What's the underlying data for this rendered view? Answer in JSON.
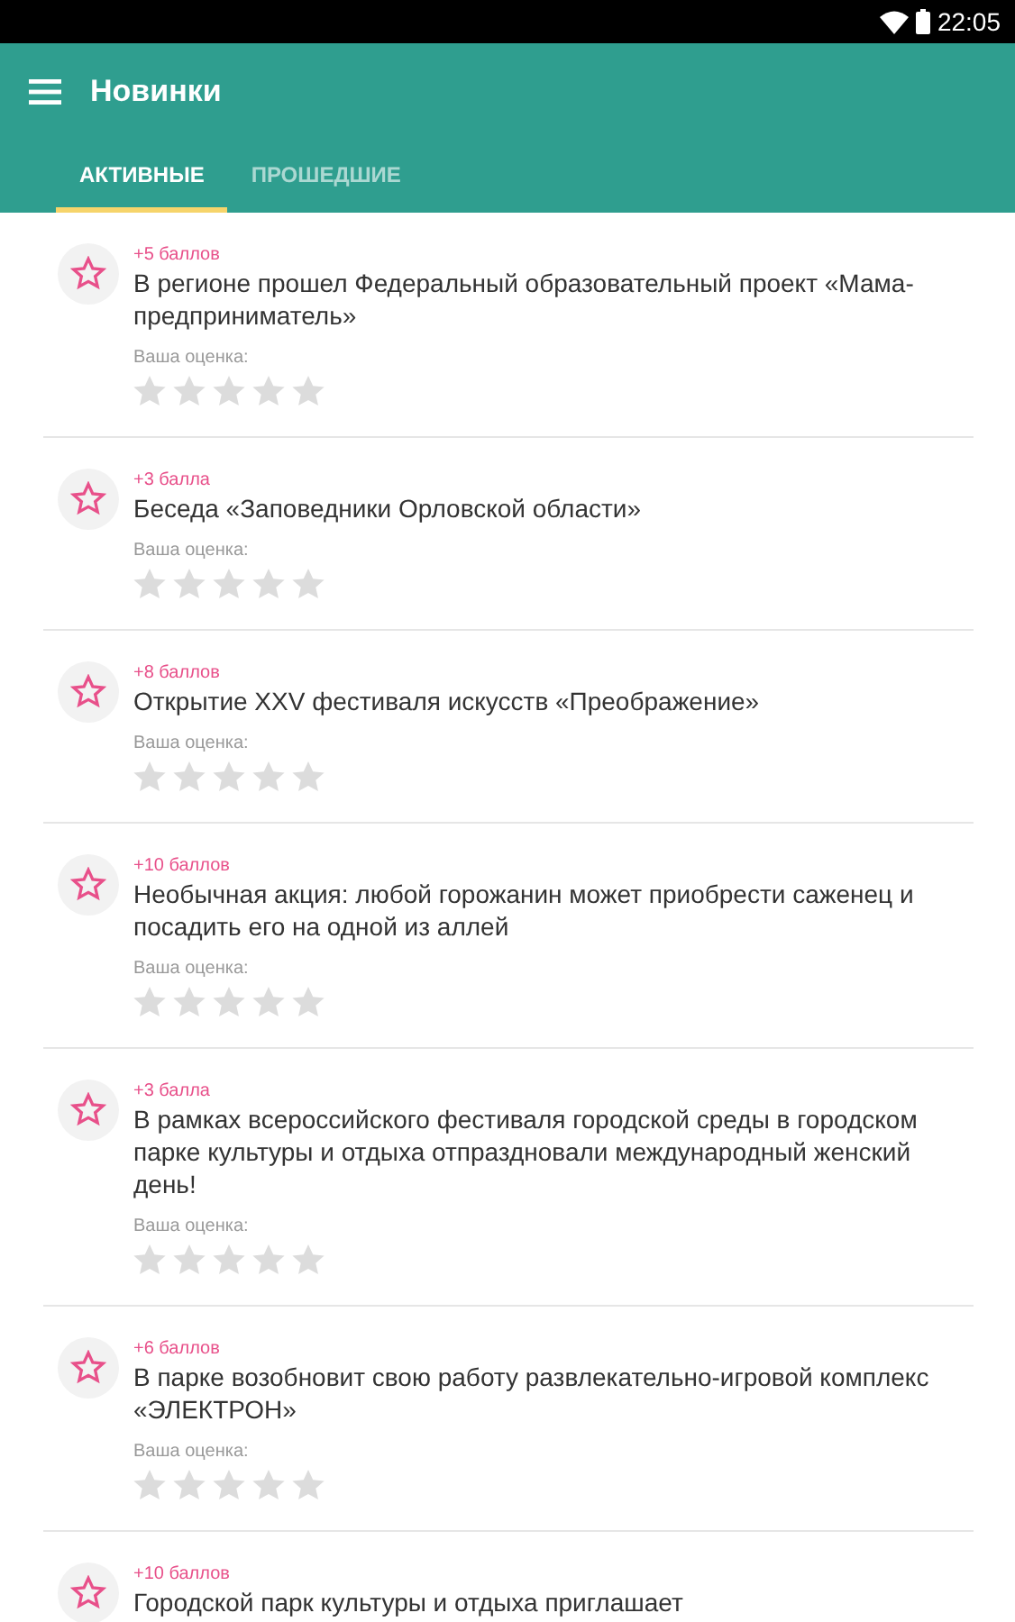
{
  "status_bar": {
    "time": "22:05"
  },
  "app_bar": {
    "title": "Новинки"
  },
  "tabs": [
    {
      "label": "АКТИВНЫЕ",
      "selected": true
    },
    {
      "label": "ПРОШЕДШИЕ",
      "selected": false
    }
  ],
  "items": [
    {
      "points": "+5 баллов",
      "title": "В регионе прошел Федеральный образовательный проект «Мама-предприниматель»",
      "rating_label": "Ваша оценка:",
      "stars": 0
    },
    {
      "points": "+3 балла",
      "title": "Беседа «Заповедники Орловской области»",
      "rating_label": "Ваша оценка:",
      "stars": 0
    },
    {
      "points": "+8 баллов",
      "title": "Открытие XXV фестиваля искусств «Преображение»",
      "rating_label": "Ваша оценка:",
      "stars": 0
    },
    {
      "points": "+10 баллов",
      "title": "Необычная акция: любой горожанин может приобрести саженец и посадить его на одной из аллей",
      "rating_label": "Ваша оценка:",
      "stars": 0
    },
    {
      "points": "+3 балла",
      "title": "В рамках всероссийского фестиваля городской среды в городском парке культуры и отдыха отпраздновали международный женский день!",
      "rating_label": "Ваша оценка:",
      "stars": 0
    },
    {
      "points": "+6 баллов",
      "title": "В парке возобновит свою работу развлекательно-игровой комплекс «ЭЛЕКТРОН»",
      "rating_label": "Ваша оценка:",
      "stars": 0
    },
    {
      "points": "+10 баллов",
      "title": "Городской парк культуры и отдыха приглашает"
    }
  ]
}
